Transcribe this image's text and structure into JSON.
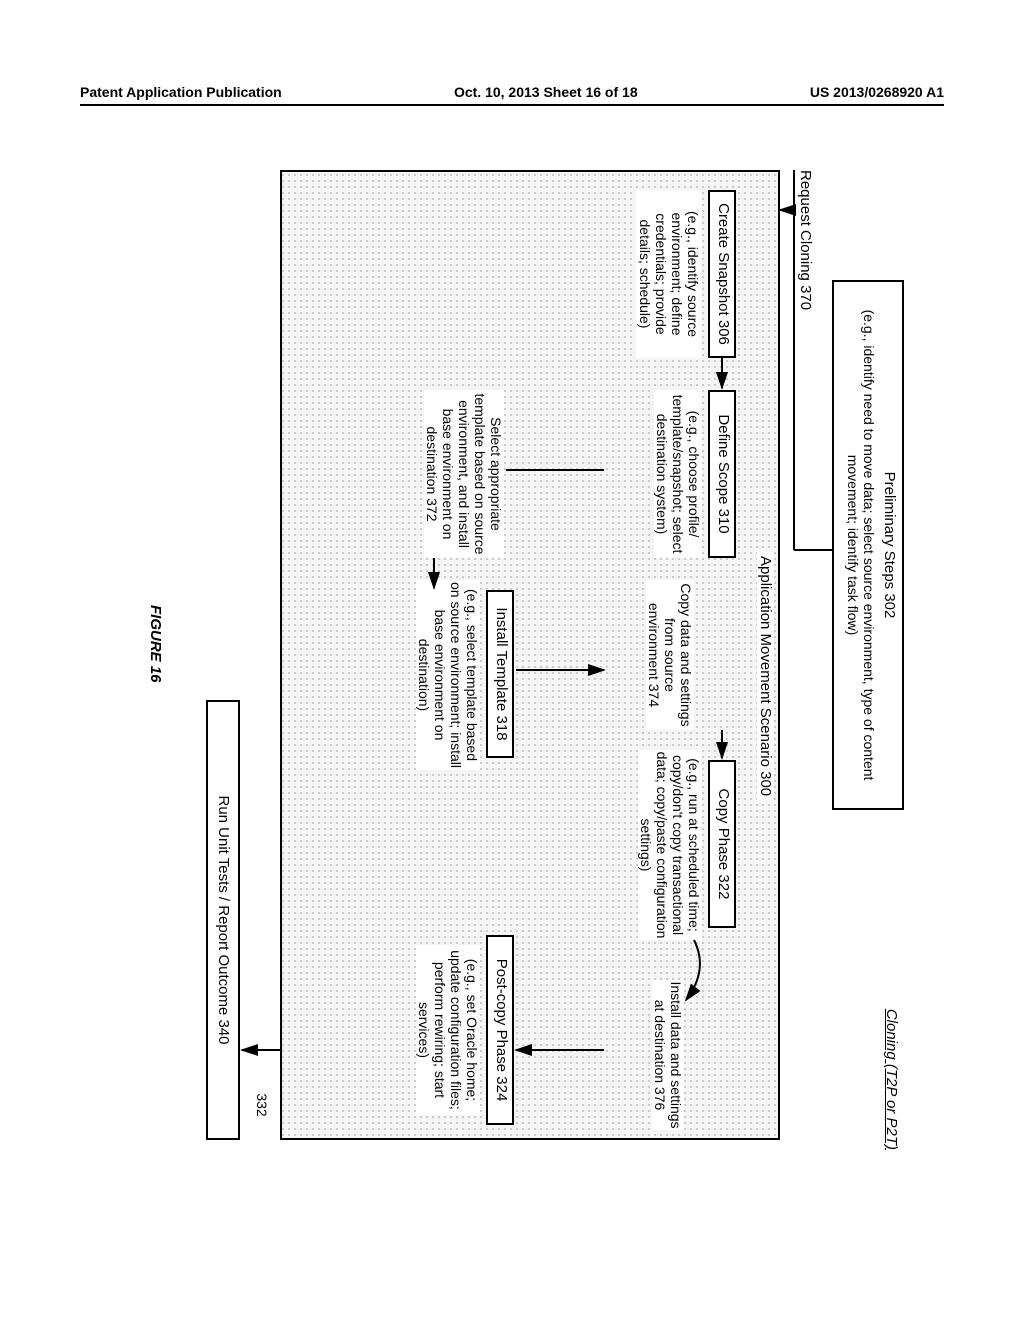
{
  "header": {
    "left": "Patent Application Publication",
    "center": "Oct. 10, 2013  Sheet 16 of 18",
    "right": "US 2013/0268920 A1"
  },
  "cloning_title": "Cloning  (T2P or P2T)",
  "prelim": {
    "title": "Preliminary Steps 302",
    "desc": "(e.g., identify need to move data; select source environment, type of content movement; identify task flow)"
  },
  "request_cloning": "Request Cloning 370",
  "scenario_label": "Application Movement Scenario 300",
  "snapshot": {
    "title": "Create Snapshot 306",
    "desc": "(e.g., identify source environment; define credentials; provide details; schedule)"
  },
  "scope": {
    "title": "Define Scope 310",
    "desc": "(e.g., choose profile/ template/snapshot; select destination system)"
  },
  "select_template": "Select appropriate template based on source environment, and install base environment on destination 372",
  "install_template": {
    "title": "Install Template 318",
    "desc": "(e.g., select template based on source environment; install base environment on destination)"
  },
  "copy_from_source": "Copy data and settings from source environment 374",
  "copy_phase": {
    "title": "Copy Phase 322",
    "desc": "(e.g., run at scheduled time; copy/don't copy transactional data; copy/paste configuration settings)"
  },
  "install_dest": "Install data and settings at destination 376",
  "postcopy": {
    "title": "Post-copy Phase 324",
    "desc": "(e.g., set Oracle home; update configuration files; perform rewiring; start services)"
  },
  "ref332": "332",
  "run_tests": "Run Unit Tests / Report Outcome 340",
  "figure": "FIGURE 16"
}
